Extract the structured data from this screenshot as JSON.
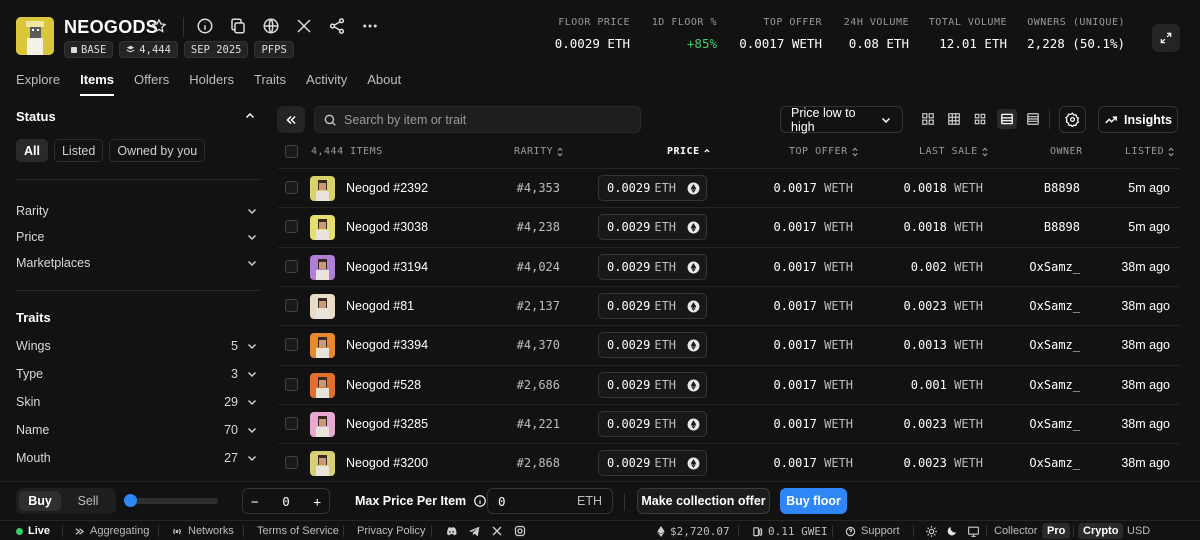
{
  "collection": {
    "name": "NEOGODS",
    "badges": [
      {
        "icon": "square-icon",
        "label": "BASE"
      },
      {
        "icon": "stack-icon",
        "label": "4,444"
      },
      {
        "icon": "",
        "label": "SEP 2025"
      },
      {
        "icon": "",
        "label": "PFPS"
      }
    ]
  },
  "stats": [
    {
      "label": "FLOOR PRICE",
      "value": "0.0029 ETH",
      "positive": false
    },
    {
      "label": "1D FLOOR %",
      "value": "+85%",
      "positive": true
    },
    {
      "label": "TOP OFFER",
      "value": "0.0017 WETH",
      "positive": false
    },
    {
      "label": "24H VOLUME",
      "value": "0.08 ETH",
      "positive": false
    },
    {
      "label": "TOTAL VOLUME",
      "value": "12.01 ETH",
      "positive": false
    },
    {
      "label": "OWNERS (UNIQUE)",
      "value": "2,228 (50.1%)",
      "positive": false
    }
  ],
  "tabs": [
    "Explore",
    "Items",
    "Offers",
    "Holders",
    "Traits",
    "Activity",
    "About"
  ],
  "active_tab": "Items",
  "sidebar": {
    "status_title": "Status",
    "status_options": [
      "All",
      "Listed",
      "Owned by you"
    ],
    "filters": [
      "Rarity",
      "Price",
      "Marketplaces"
    ],
    "traits_title": "Traits",
    "traits": [
      {
        "name": "Wings",
        "count": "5"
      },
      {
        "name": "Type",
        "count": "3"
      },
      {
        "name": "Skin",
        "count": "29"
      },
      {
        "name": "Name",
        "count": "70"
      },
      {
        "name": "Mouth",
        "count": "27"
      }
    ]
  },
  "toolbar": {
    "search_placeholder": "Search by item or trait",
    "sort_label": "Price low to high",
    "insights_label": "Insights"
  },
  "table": {
    "headers": {
      "items": "4,444 ITEMS",
      "rarity": "RARITY",
      "price": "PRICE",
      "top_offer": "TOP OFFER",
      "last_sale": "LAST SALE",
      "owner": "OWNER",
      "listed": "LISTED"
    },
    "rows": [
      {
        "name": "Neogod #2392",
        "rarity": "#4,353",
        "price": "0.0029",
        "price_cur": "ETH",
        "top_offer": "0.0017",
        "top_offer_cur": "WETH",
        "last_sale": "0.0018",
        "last_sale_cur": "WETH",
        "owner": "B8898",
        "listed": "5m ago",
        "thumb_color": "#d9d26a"
      },
      {
        "name": "Neogod #3038",
        "rarity": "#4,238",
        "price": "0.0029",
        "price_cur": "ETH",
        "top_offer": "0.0017",
        "top_offer_cur": "WETH",
        "last_sale": "0.0018",
        "last_sale_cur": "WETH",
        "owner": "B8898",
        "listed": "5m ago",
        "thumb_color": "#e6df6f"
      },
      {
        "name": "Neogod #3194",
        "rarity": "#4,024",
        "price": "0.0029",
        "price_cur": "ETH",
        "top_offer": "0.0017",
        "top_offer_cur": "WETH",
        "last_sale": "0.002",
        "last_sale_cur": "WETH",
        "owner": "OxSamz_",
        "listed": "38m ago",
        "thumb_color": "#b27fd6"
      },
      {
        "name": "Neogod #81",
        "rarity": "#2,137",
        "price": "0.0029",
        "price_cur": "ETH",
        "top_offer": "0.0017",
        "top_offer_cur": "WETH",
        "last_sale": "0.0023",
        "last_sale_cur": "WETH",
        "owner": "OxSamz_",
        "listed": "38m ago",
        "thumb_color": "#e9ddc8"
      },
      {
        "name": "Neogod #3394",
        "rarity": "#4,370",
        "price": "0.0029",
        "price_cur": "ETH",
        "top_offer": "0.0017",
        "top_offer_cur": "WETH",
        "last_sale": "0.0013",
        "last_sale_cur": "WETH",
        "owner": "OxSamz_",
        "listed": "38m ago",
        "thumb_color": "#e8892e"
      },
      {
        "name": "Neogod #528",
        "rarity": "#2,686",
        "price": "0.0029",
        "price_cur": "ETH",
        "top_offer": "0.0017",
        "top_offer_cur": "WETH",
        "last_sale": "0.001",
        "last_sale_cur": "WETH",
        "owner": "OxSamz_",
        "listed": "38m ago",
        "thumb_color": "#e2702c"
      },
      {
        "name": "Neogod #3285",
        "rarity": "#4,221",
        "price": "0.0029",
        "price_cur": "ETH",
        "top_offer": "0.0017",
        "top_offer_cur": "WETH",
        "last_sale": "0.0023",
        "last_sale_cur": "WETH",
        "owner": "OxSamz_",
        "listed": "38m ago",
        "thumb_color": "#e7a9d2"
      },
      {
        "name": "Neogod #3200",
        "rarity": "#2,868",
        "price": "0.0029",
        "price_cur": "ETH",
        "top_offer": "0.0017",
        "top_offer_cur": "WETH",
        "last_sale": "0.0023",
        "last_sale_cur": "WETH",
        "owner": "OxSamz_",
        "listed": "38m ago",
        "thumb_color": "#d6cf73"
      }
    ]
  },
  "bottom": {
    "buy_label": "Buy",
    "sell_label": "Sell",
    "quantity": "0",
    "stepper_minus": "−",
    "stepper_plus": "+",
    "max_price_label": "Max Price Per Item",
    "max_price_value": "0",
    "max_price_currency": "ETH",
    "collection_offer_label": "Make collection offer",
    "buy_floor_label": "Buy floor"
  },
  "footer": {
    "live": "Live",
    "aggregating": "Aggregating",
    "networks": "Networks",
    "terms": "Terms of Service",
    "privacy": "Privacy Policy",
    "eth_price": "$2,720.07",
    "gas": "0.11 GWEI",
    "support": "Support",
    "mode_collector": "Collector",
    "mode_pro": "Pro",
    "currency_crypto": "Crypto",
    "currency_usd": "USD"
  },
  "colors": {
    "accent": "#2f86f6",
    "positive": "#3fcf6a",
    "background": "#121212",
    "logo_bg": "#d9c63a"
  }
}
